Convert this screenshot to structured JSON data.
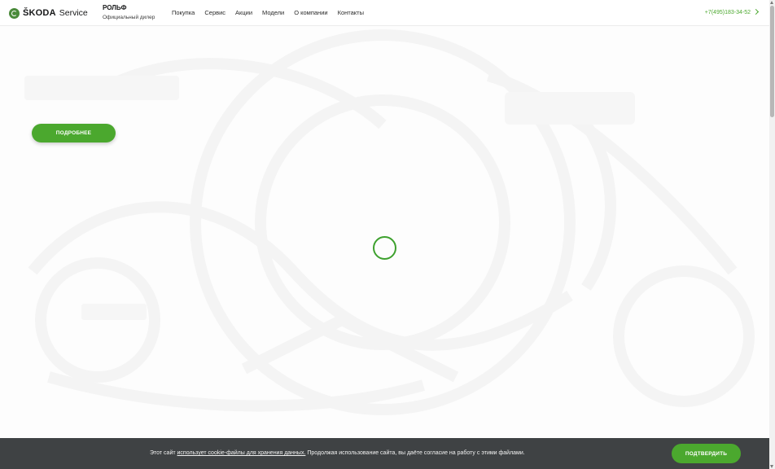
{
  "header": {
    "logo": {
      "brand": "ŠKODA",
      "service": "Service",
      "icon": "skoda-emblem-icon"
    },
    "dealer": {
      "name": "РОЛЬФ",
      "subtitle": "Официальный дилер"
    },
    "nav": [
      "Покупка",
      "Сервис",
      "Акции",
      "Модели",
      "О компании",
      "Контакты"
    ],
    "phone": "+7(495)183-34-52",
    "phone_icon": "chevron-right-icon"
  },
  "hero": {
    "more_button": "ПОДРОБНЕЕ",
    "loading_icon": "loading-spinner-icon"
  },
  "cookie": {
    "text_before": "Этот сайт ",
    "link_text": "использует cookie-файлы для хранения данных.",
    "text_after": " Продолжая использование сайта, вы даёте согласие на работу с этими файлами.",
    "confirm_button": "ПОДТВЕРДИТЬ"
  },
  "colors": {
    "accent": "#4ba82e",
    "cookie_bar": "#3f4244",
    "text": "#161718"
  }
}
